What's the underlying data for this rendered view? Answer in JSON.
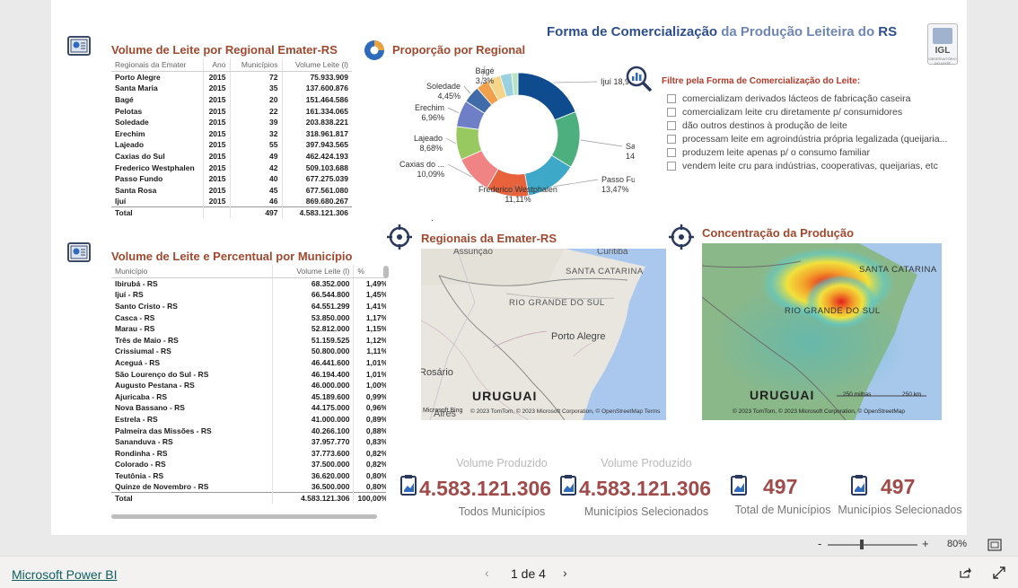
{
  "report": {
    "title_part1": "Forma de Comercialização",
    "title_part2": " da Produção Leiteira do RS",
    "title_part3": "RS",
    "logo_text": "IGL",
    "logo_sub": "OBSERVATÓRIO DO LEITE"
  },
  "regional_table": {
    "title": "Volume de Leite por Regional Emater-RS",
    "headers": [
      "Regionais da Emater",
      "Ano",
      "Municípios",
      "Volume Leite (l)"
    ],
    "rows": [
      [
        "Porto Alegre",
        "2015",
        "72",
        "75.933.909"
      ],
      [
        "Santa Maria",
        "2015",
        "35",
        "137.600.876"
      ],
      [
        "Bagé",
        "2015",
        "20",
        "151.464.586"
      ],
      [
        "Pelotas",
        "2015",
        "22",
        "161.334.065"
      ],
      [
        "Soledade",
        "2015",
        "39",
        "203.838.221"
      ],
      [
        "Erechim",
        "2015",
        "32",
        "318.961.817"
      ],
      [
        "Lajeado",
        "2015",
        "55",
        "397.943.565"
      ],
      [
        "Caxias do Sul",
        "2015",
        "49",
        "462.424.193"
      ],
      [
        "Frederico Westphalen",
        "2015",
        "42",
        "509.103.688"
      ],
      [
        "Passo Fundo",
        "2015",
        "40",
        "677.275.039"
      ],
      [
        "Santa Rosa",
        "2015",
        "45",
        "677.561.080"
      ],
      [
        "Ijuí",
        "2015",
        "46",
        "869.680.267"
      ]
    ],
    "total": [
      "Total",
      "",
      "497",
      "4.583.121.306"
    ]
  },
  "municipio_table": {
    "title": "Volume de Leite e Percentual por Município",
    "headers": [
      "Município",
      "Volume Leite (l)",
      "%"
    ],
    "rows": [
      [
        "Ibirubá - RS",
        "68.352.000",
        "1,49%"
      ],
      [
        "Ijuí - RS",
        "66.544.800",
        "1,45%"
      ],
      [
        "Santo Cristo - RS",
        "64.551.299",
        "1,41%"
      ],
      [
        "Casca - RS",
        "53.850.000",
        "1,17%"
      ],
      [
        "Marau - RS",
        "52.812.000",
        "1,15%"
      ],
      [
        "Três de Maio - RS",
        "51.159.525",
        "1,12%"
      ],
      [
        "Crissiumal - RS",
        "50.800.000",
        "1,11%"
      ],
      [
        "Aceguá - RS",
        "46.441.600",
        "1,01%"
      ],
      [
        "São Lourenço do Sul - RS",
        "46.194.400",
        "1,01%"
      ],
      [
        "Augusto Pestana - RS",
        "46.000.000",
        "1,00%"
      ],
      [
        "Ajuricaba - RS",
        "45.189.600",
        "0,99%"
      ],
      [
        "Nova Bassano - RS",
        "44.175.000",
        "0,96%"
      ],
      [
        "Estrela - RS",
        "41.000.000",
        "0,89%"
      ],
      [
        "Palmeira das Missões - RS",
        "40.266.100",
        "0,88%"
      ],
      [
        "Sananduva - RS",
        "37.957.770",
        "0,83%"
      ],
      [
        "Rondinha - RS",
        "37.773.600",
        "0,82%"
      ],
      [
        "Colorado - RS",
        "37.500.000",
        "0,82%"
      ],
      [
        "Teutônia - RS",
        "36.620.000",
        "0,80%"
      ],
      [
        "Quinze de Novembro - RS",
        "36.500.000",
        "0,80%"
      ]
    ],
    "total": [
      "Total",
      "4.583.121.306",
      "100,00%"
    ]
  },
  "donut": {
    "title": "Proporção por Regional"
  },
  "chart_data": {
    "type": "pie",
    "title": "Proporção por Regional",
    "categories": [
      "Ijuí",
      "Santa Rosa",
      "Passo Fundo",
      "Frederico Westphalen",
      "Caxias do ...",
      "Lajeado",
      "Erechim",
      "Soledade",
      "Bagé",
      "Pelotas",
      "Santa Maria",
      "Porto Alegre"
    ],
    "values": [
      18.98,
      14.78,
      13.47,
      11.11,
      10.09,
      8.68,
      6.96,
      4.45,
      3.3,
      3.52,
      3.0,
      1.66
    ],
    "labels": [
      "Ijuí 18,98%",
      "Santa Rosa 14,78%",
      "Passo Fundo 13,47%",
      "Frederico Westphalen 11,11%",
      "Caxias do ... 10,09%",
      "Lajeado 8,68%",
      "Erechim 6,96%",
      "Soledade 4,45%",
      "Bagé 3,3%",
      "",
      "",
      ""
    ],
    "colors": [
      "#0f4b8f",
      "#4caf7d",
      "#3ea8c8",
      "#e8633c",
      "#f08484",
      "#97c960",
      "#6f7fc7",
      "#3f6ba8",
      "#f0a04b",
      "#f5d58a",
      "#9ad1e0",
      "#b9e4c2"
    ]
  },
  "filter": {
    "title": "Filtre pela Forma de Comercialização do Leite:",
    "options": [
      "comercializam derivados lácteos de fabricação caseira",
      "comercializam leite cru diretamente p/ consumidores",
      "dão outros destinos à produção de leite",
      "processam leite em agroindústria própria legalizada (queijaria...",
      "produzem leite apenas p/ o consumo familiar",
      "vendem leite cru para indústrias, cooperativas, queijarias, etc"
    ]
  },
  "map1": {
    "title": "Regionais da Emater-RS",
    "labels": [
      "Assunção",
      "Curitiba",
      "SANTA CATARINA",
      "RIO GRANDE DO SUL",
      "Porto Alegre",
      "Rosário",
      "URUGUAI",
      "Aires"
    ],
    "attribution": "© 2023 TomTom, © 2023 Microsoft Corporation, © OpenStreetMap  Terms",
    "bing": "Microsoft Bing"
  },
  "map2": {
    "title": "Concentração da Produção",
    "labels": [
      "SANTA CATARINA",
      "RIO GRANDE DO SUL",
      "URUGUAI"
    ],
    "scale1": "250 milhas",
    "scale2": "250 km",
    "attribution": "© 2023 TomTom, © 2023 Microsoft Corporation, © OpenStreetMap"
  },
  "kpis": [
    {
      "label": "Volume Produzido",
      "value": "4.583.121.306",
      "sub": "Todos Municípios"
    },
    {
      "label": "Volume Produzido",
      "value": "4.583.121.306",
      "sub": "Municípios Selecionados"
    },
    {
      "label": "",
      "value": "497",
      "sub": "Total de Municípios"
    },
    {
      "label": "",
      "value": "497",
      "sub": "Municípios Selecionados"
    }
  ],
  "zoom": {
    "minus": "-",
    "plus": "+",
    "level": "80%"
  },
  "footer": {
    "link": "Microsoft Power BI",
    "page": "1 de 4"
  }
}
